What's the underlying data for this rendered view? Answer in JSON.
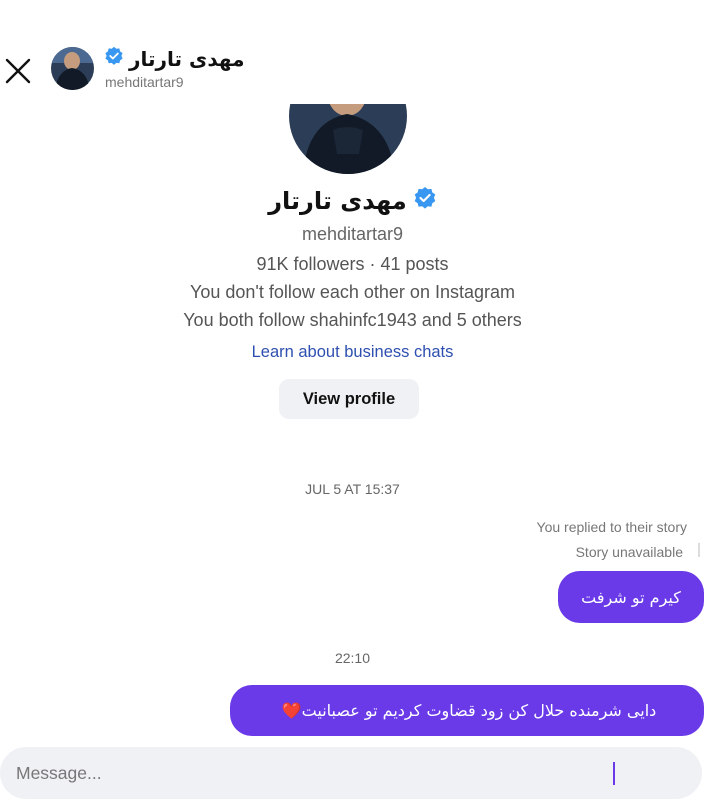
{
  "header": {
    "name": "مهدی تارتار",
    "username": "mehditartar9",
    "close_icon": "close-icon",
    "verified_icon": "verified-badge-icon"
  },
  "profile": {
    "name": "مهدی تارتار",
    "username": "mehditartar9",
    "stats": "91K followers · 41 posts",
    "follow_status": "You don't follow each other on Instagram",
    "mutuals": "You both follow shahinfc1943 and 5 others",
    "learn_link": "Learn about business chats",
    "view_profile_label": "View profile"
  },
  "thread": {
    "timestamp1": "JUL 5 AT 15:37",
    "story_reply_note": "You replied to their story",
    "story_status": "Story unavailable",
    "message1": "کیرم تو شرفت",
    "timestamp2": "22:10",
    "message2": "دایی شرمنده حلال کن زود قضاوت کردیم تو عصبانیت",
    "message2_emoji": "❤️"
  },
  "composer": {
    "placeholder": "Message..."
  },
  "colors": {
    "bubble": "#6a3ae8",
    "link": "#2e4fb0",
    "verified": "#3897f0",
    "composer_bg": "#f0f1f5"
  }
}
